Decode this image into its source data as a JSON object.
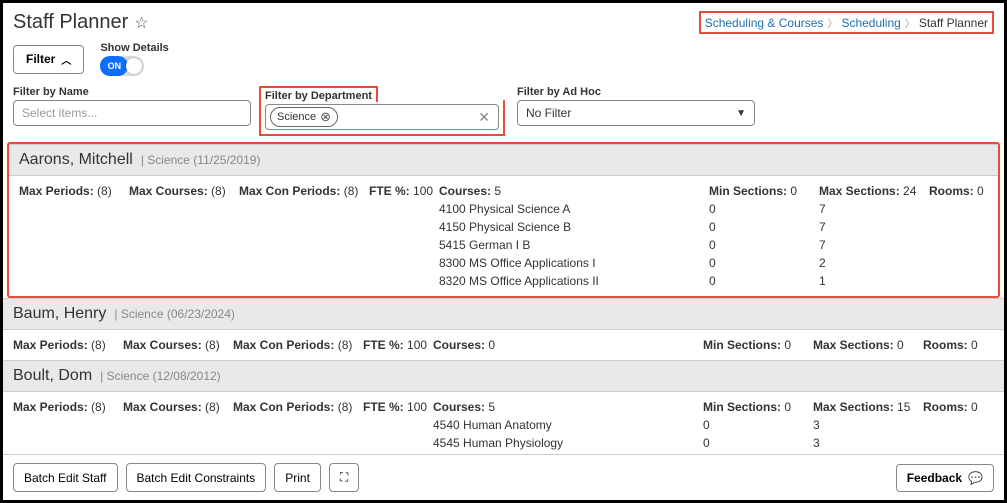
{
  "header": {
    "title": "Staff Planner"
  },
  "breadcrumb": {
    "l1": "Scheduling & Courses",
    "l2": "Scheduling",
    "current": "Staff Planner"
  },
  "controls": {
    "filter_btn": "Filter",
    "show_details_label": "Show Details",
    "toggle_text": "ON"
  },
  "filters": {
    "name_label": "Filter by Name",
    "name_placeholder": "Select items...",
    "dept_label": "Filter by Department",
    "dept_chip": "Science",
    "adhoc_label": "Filter by Ad Hoc",
    "adhoc_value": "No Filter"
  },
  "stat_labels": {
    "max_periods": "Max Periods:",
    "max_courses": "Max Courses:",
    "max_con": "Max Con Periods:",
    "fte": "FTE %:",
    "courses": "Courses:",
    "min_sections": "Min Sections:",
    "max_sections": "Max Sections:",
    "rooms": "Rooms:"
  },
  "staff": [
    {
      "name": "Aarons, Mitchell",
      "meta": "| Science (11/25/2019)",
      "max_periods": "(8)",
      "max_courses": "(8)",
      "max_con": "(8)",
      "fte": "100",
      "courses_count": "5",
      "min_sections": "0",
      "max_sections": "24",
      "rooms": "0",
      "courses": [
        {
          "name": "4100 Physical Science A",
          "min": "0",
          "max": "7"
        },
        {
          "name": "4150 Physical Science B",
          "min": "0",
          "max": "7"
        },
        {
          "name": "5415 German I B",
          "min": "0",
          "max": "7"
        },
        {
          "name": "8300 MS Office Applications I",
          "min": "0",
          "max": "2"
        },
        {
          "name": "8320 MS Office Applications II",
          "min": "0",
          "max": "1"
        }
      ]
    },
    {
      "name": "Baum, Henry",
      "meta": "| Science (06/23/2024)",
      "max_periods": "(8)",
      "max_courses": "(8)",
      "max_con": "(8)",
      "fte": "100",
      "courses_count": "0",
      "min_sections": "0",
      "max_sections": "0",
      "rooms": "0",
      "courses": []
    },
    {
      "name": "Boult, Dom",
      "meta": "| Science (12/08/2012)",
      "max_periods": "(8)",
      "max_courses": "(8)",
      "max_con": "(8)",
      "fte": "100",
      "courses_count": "5",
      "min_sections": "0",
      "max_sections": "15",
      "rooms": "0",
      "courses": [
        {
          "name": "4540 Human Anatomy",
          "min": "0",
          "max": "3"
        },
        {
          "name": "4545 Human Physiology",
          "min": "0",
          "max": "3"
        }
      ]
    }
  ],
  "footer": {
    "batch_edit_staff": "Batch Edit Staff",
    "batch_edit_constraints": "Batch Edit Constraints",
    "print": "Print",
    "feedback": "Feedback"
  }
}
